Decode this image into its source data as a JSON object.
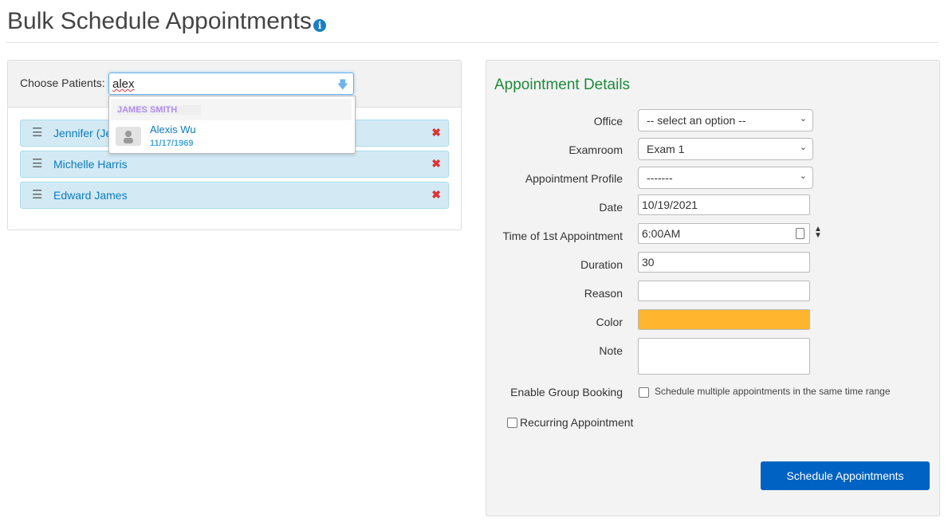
{
  "page": {
    "title": "Bulk Schedule Appointments",
    "info_icon": "info-circle-icon"
  },
  "patients": {
    "label": "Choose Patients:",
    "search_value": "alex",
    "dropdown": {
      "group": "JAMES SMITH",
      "result_name": "Alexis Wu",
      "result_dob": "11/17/1969"
    },
    "selected": [
      {
        "name": "Jennifer (Je"
      },
      {
        "name": "Michelle Harris"
      },
      {
        "name": "Edward James"
      }
    ]
  },
  "details": {
    "heading": "Appointment Details",
    "office": {
      "label": "Office",
      "value": "-- select an option --"
    },
    "examroom": {
      "label": "Examroom",
      "value": "Exam 1"
    },
    "profile": {
      "label": "Appointment Profile",
      "value": "-------"
    },
    "date": {
      "label": "Date",
      "value": "10/19/2021"
    },
    "time": {
      "label": "Time of 1st Appointment",
      "value": "6:00AM"
    },
    "duration": {
      "label": "Duration",
      "value": "30"
    },
    "reason": {
      "label": "Reason",
      "value": ""
    },
    "color": {
      "label": "Color",
      "value": "#ffb52e"
    },
    "note": {
      "label": "Note",
      "value": ""
    },
    "group": {
      "label": "Enable Group Booking",
      "desc": "Schedule multiple appointments in the same time range",
      "checked": false
    },
    "recurring": {
      "label": "Recurring Appointment",
      "checked": false
    },
    "submit": "Schedule Appointments"
  }
}
